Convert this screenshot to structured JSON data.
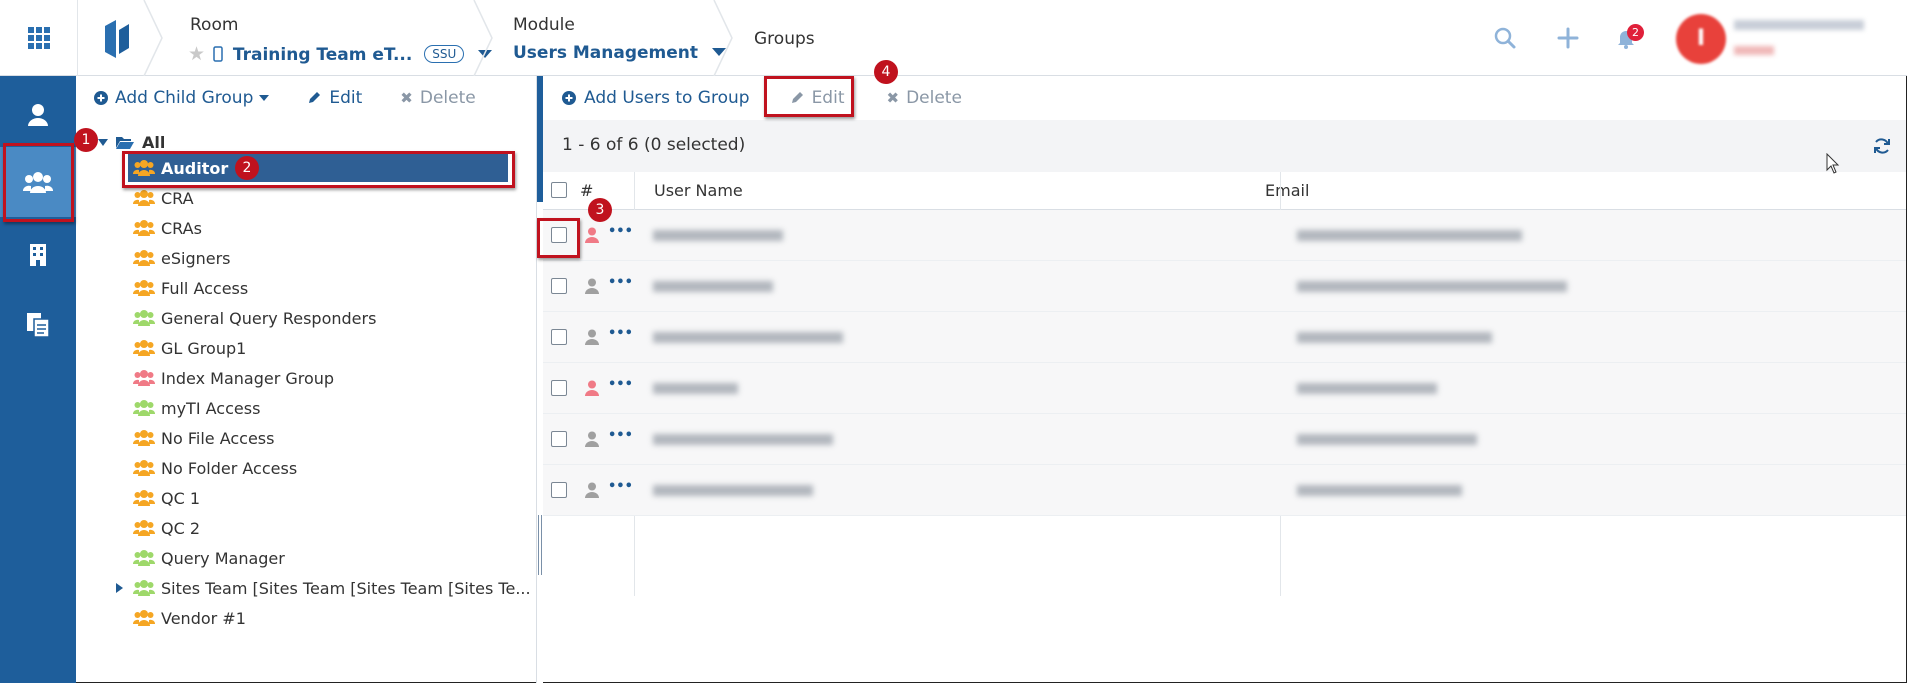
{
  "topbar": {
    "room_label": "Room",
    "room_value": "Training Team eT...",
    "room_badge": "SSU",
    "module_label": "Module",
    "module_value": "Users Management",
    "page_title": "Groups",
    "notification_count": "2",
    "avatar_letter": "I"
  },
  "tree_toolbar": {
    "add_child": "Add Child Group",
    "edit": "Edit",
    "delete": "Delete"
  },
  "tree": {
    "root": "All",
    "items": [
      {
        "label": "Auditor",
        "color": "#f5a623"
      },
      {
        "label": "CRA",
        "color": "#f5a623"
      },
      {
        "label": "CRAs",
        "color": "#f5a623"
      },
      {
        "label": "eSigners",
        "color": "#f5a623"
      },
      {
        "label": "Full Access",
        "color": "#f5a623"
      },
      {
        "label": "General Query Responders",
        "color": "#9ed86a"
      },
      {
        "label": "GL Group1",
        "color": "#f5a623"
      },
      {
        "label": "Index Manager Group",
        "color": "#f07a86"
      },
      {
        "label": "myTI Access",
        "color": "#9ed86a"
      },
      {
        "label": "No File Access",
        "color": "#f5a623"
      },
      {
        "label": "No Folder Access",
        "color": "#f5a623"
      },
      {
        "label": "QC 1",
        "color": "#f5a623"
      },
      {
        "label": "QC 2",
        "color": "#f5a623"
      },
      {
        "label": "Query Manager",
        "color": "#9ed86a"
      },
      {
        "label": "Sites Team [Sites Team [Sites Team [Sites Te...",
        "color": "#9ed86a"
      },
      {
        "label": "Vendor #1",
        "color": "#f5a623"
      }
    ]
  },
  "main_toolbar": {
    "add_users": "Add Users to Group",
    "edit": "Edit",
    "delete": "Delete"
  },
  "table": {
    "count": "1 - 6 of 6 (0 selected)",
    "headers": {
      "num": "#",
      "user_name": "User Name",
      "email": "Email"
    },
    "rows": [
      {
        "icon_color": "#f07a86"
      },
      {
        "icon_color": "#a0a0a0"
      },
      {
        "icon_color": "#a0a0a0"
      },
      {
        "icon_color": "#f07a86"
      },
      {
        "icon_color": "#a0a0a0"
      },
      {
        "icon_color": "#a0a0a0"
      }
    ]
  },
  "callouts": [
    "1",
    "2",
    "3",
    "4"
  ],
  "colors": {
    "brand": "#1e5e9b",
    "link": "#1f5a92",
    "callout": "#c0121e"
  }
}
